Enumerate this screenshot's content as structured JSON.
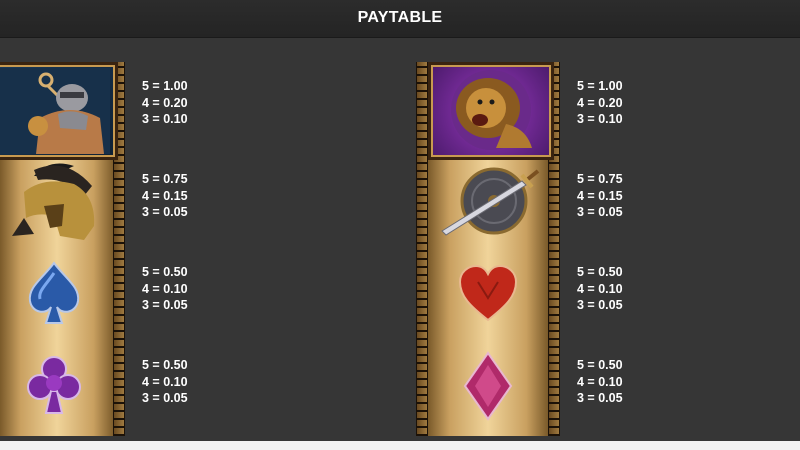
{
  "header": {
    "title": "PAYTABLE"
  },
  "colors": {
    "background": "#363636",
    "header_bg": "#262626",
    "column_gold": "#f0d49a",
    "spade_blue": "#2a5aa8",
    "club_purple": "#7a2aa0",
    "heart_red": "#c0281a",
    "diamond_pink": "#b02a6a"
  },
  "symbols": [
    {
      "icon": "gladiator-icon",
      "pays": [
        "5 = 1.00",
        "4 = 0.20",
        "3 = 0.10"
      ]
    },
    {
      "icon": "helmet-icon",
      "pays": [
        "5 = 0.75",
        "4 = 0.15",
        "3 = 0.05"
      ]
    },
    {
      "icon": "spade-icon",
      "pays": [
        "5 = 0.50",
        "4 = 0.10",
        "3 = 0.05"
      ]
    },
    {
      "icon": "club-icon",
      "pays": [
        "5 = 0.50",
        "4 = 0.10",
        "3 = 0.05"
      ]
    },
    {
      "icon": "lion-icon",
      "pays": [
        "5 = 1.00",
        "4 = 0.20",
        "3 = 0.10"
      ]
    },
    {
      "icon": "sword-shield-icon",
      "pays": [
        "5 = 0.75",
        "4 = 0.15",
        "3 = 0.05"
      ]
    },
    {
      "icon": "heart-icon",
      "pays": [
        "5 = 0.50",
        "4 = 0.10",
        "3 = 0.05"
      ]
    },
    {
      "icon": "diamond-icon",
      "pays": [
        "5 = 0.50",
        "4 = 0.10",
        "3 = 0.05"
      ]
    }
  ]
}
